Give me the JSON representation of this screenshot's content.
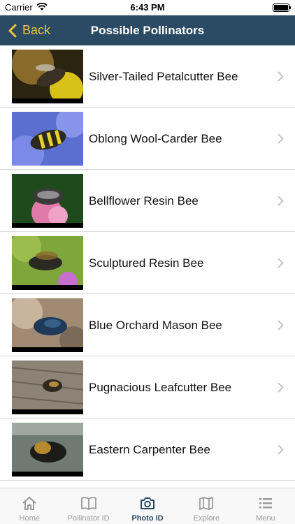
{
  "status_bar": {
    "carrier": "Carrier",
    "time": "6:43 PM"
  },
  "nav": {
    "back_label": "Back",
    "title": "Possible Pollinators"
  },
  "items": [
    {
      "name": "Silver-Tailed Petalcutter Bee"
    },
    {
      "name": "Oblong Wool-Carder Bee"
    },
    {
      "name": "Bellflower Resin Bee"
    },
    {
      "name": "Sculptured Resin Bee"
    },
    {
      "name": "Blue Orchard Mason Bee"
    },
    {
      "name": "Pugnacious Leafcutter Bee"
    },
    {
      "name": "Eastern Carpenter Bee"
    }
  ],
  "tabs": [
    {
      "label": "Home",
      "icon": "home-icon"
    },
    {
      "label": "Pollinator ID",
      "icon": "book-icon"
    },
    {
      "label": "Photo ID",
      "icon": "camera-icon",
      "active": true
    },
    {
      "label": "Explore",
      "icon": "map-icon"
    },
    {
      "label": "Menu",
      "icon": "menu-icon"
    }
  ],
  "colors": {
    "nav_bg": "#2b4a63",
    "accent": "#f2c53d",
    "tab_active": "#2b4a63",
    "tab_inactive": "#9a9a9a"
  }
}
